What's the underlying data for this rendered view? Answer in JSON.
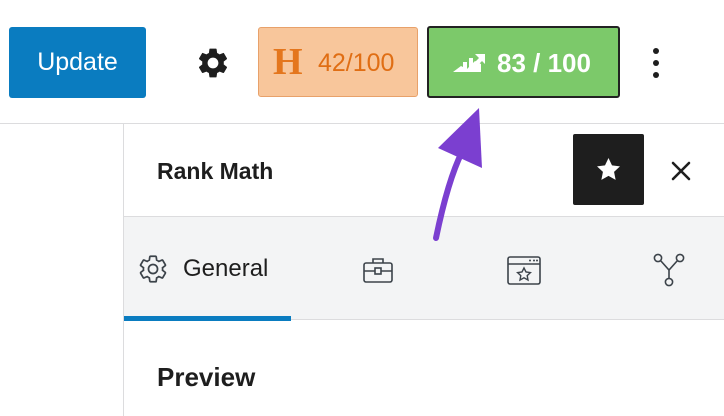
{
  "toolbar": {
    "update_label": "Update",
    "headline_score": {
      "mark": "H",
      "value": "42/100"
    },
    "seo_score": {
      "value": "83 / 100"
    }
  },
  "sidebar": {
    "title": "Rank Math",
    "tabs": [
      {
        "label": "General",
        "icon": "gear-icon",
        "active": true
      },
      {
        "label": "",
        "icon": "toolbox-icon",
        "active": false
      },
      {
        "label": "",
        "icon": "schema-icon",
        "active": false
      },
      {
        "label": "",
        "icon": "social-share-icon",
        "active": false
      }
    ],
    "section_heading": "Preview"
  },
  "colors": {
    "update_button": "#0a7cc0",
    "headline_bg": "#f8c69b",
    "headline_text": "#e06e14",
    "seo_score_bg": "#7cc96a",
    "active_tab": "#0a7cc0",
    "annotation_arrow": "#7b3fd0"
  }
}
